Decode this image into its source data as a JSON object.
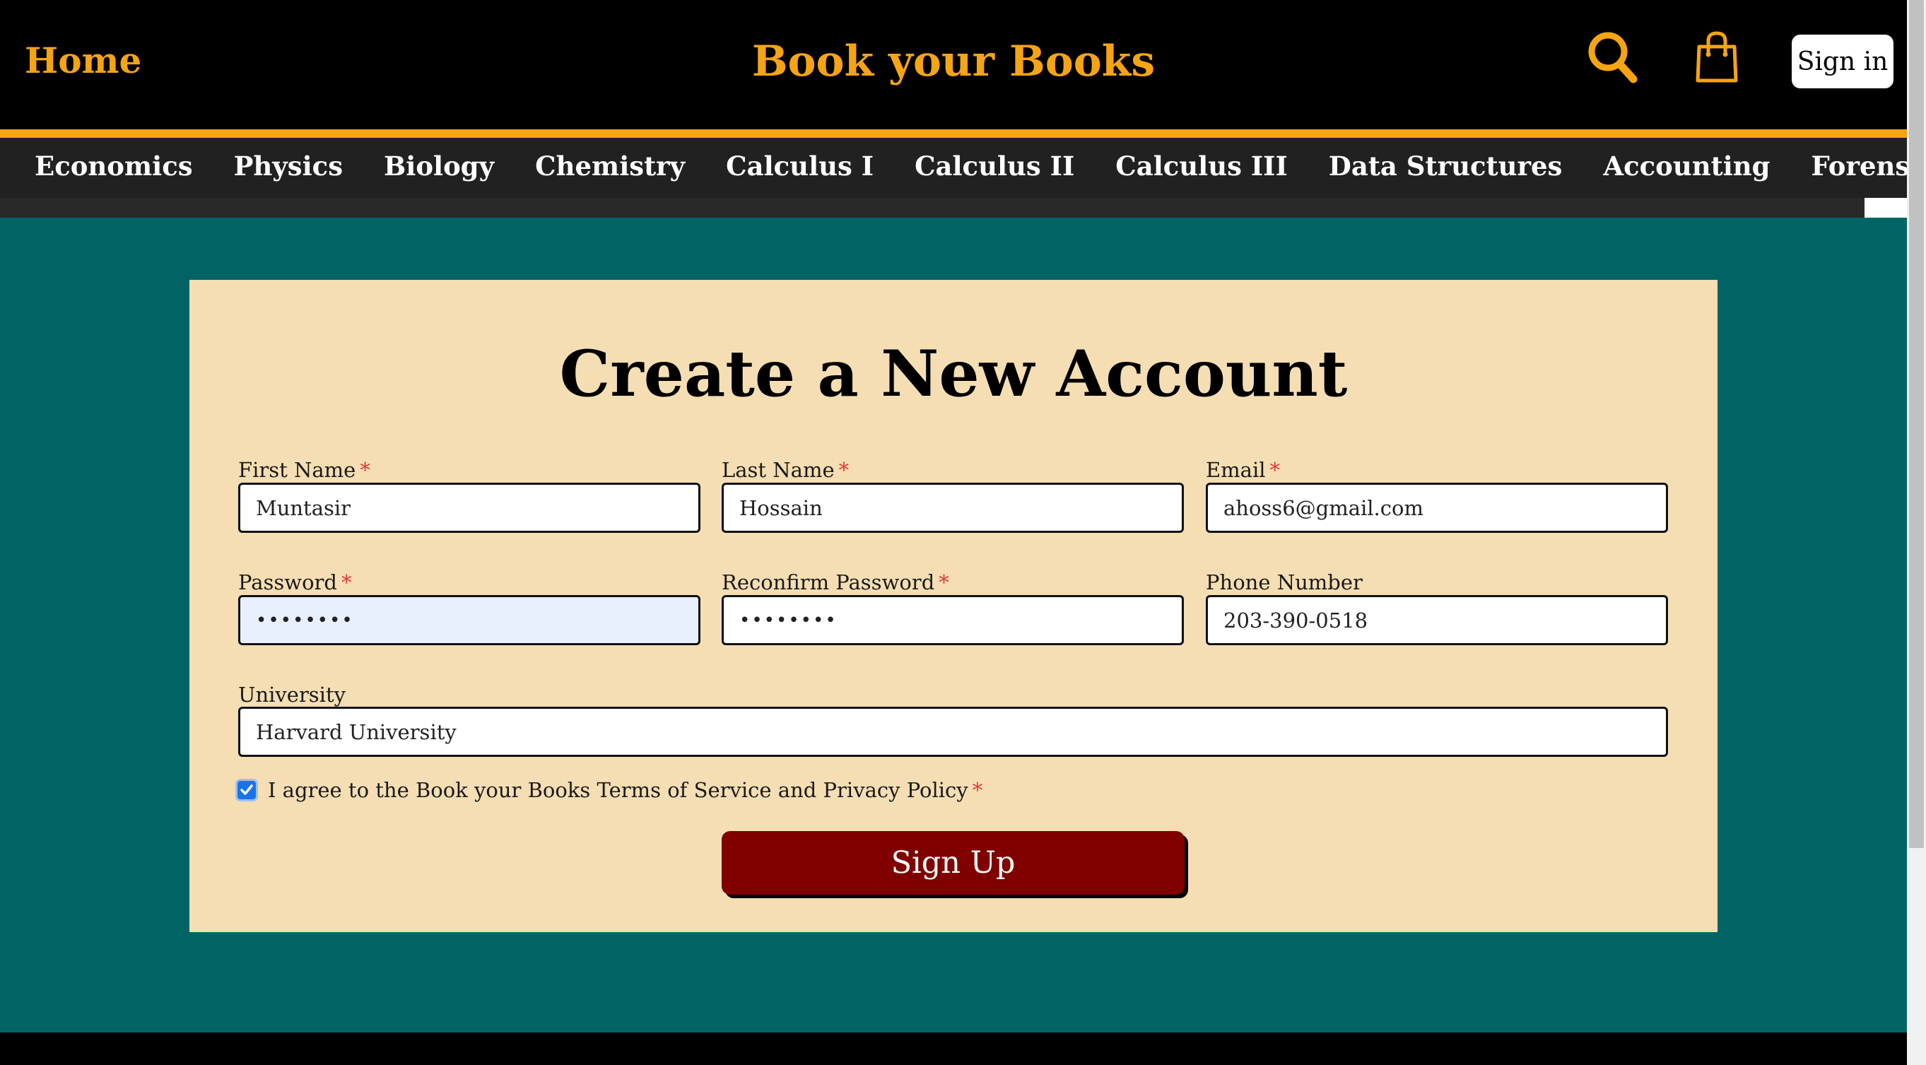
{
  "header": {
    "home_label": "Home",
    "brand": "Book your Books",
    "search_icon": "search-icon",
    "cart_icon": "shopping-bag-icon",
    "signin_label": "Sign in"
  },
  "categories": [
    "Economics",
    "Physics",
    "Biology",
    "Chemistry",
    "Calculus I",
    "Calculus II",
    "Calculus III",
    "Data Structures",
    "Accounting",
    "Forensic Science"
  ],
  "form": {
    "title": "Create a New Account",
    "required_marker": "*",
    "first_name": {
      "label": "First Name",
      "value": "Muntasir"
    },
    "last_name": {
      "label": "Last Name",
      "value": "Hossain"
    },
    "email": {
      "label": "Email",
      "value": "ahoss6@gmail.com"
    },
    "password": {
      "label": "Password",
      "value": "••••••••"
    },
    "reconfirm_password": {
      "label": "Reconfirm Password",
      "value": "••••••••"
    },
    "phone": {
      "label": "Phone Number",
      "value": "203-390-0518"
    },
    "university": {
      "label": "University",
      "value": "Harvard University"
    },
    "terms": {
      "label": "I agree to the Book your Books Terms of Service and Privacy Policy",
      "checked": true
    },
    "submit_label": "Sign Up"
  },
  "colors": {
    "accent": "#f5a414",
    "header_bg": "#000000",
    "nav_bg": "#212121",
    "page_bg": "#006464",
    "card_bg": "#f5deb3",
    "button_bg": "#800000",
    "required": "#e53935",
    "checkbox": "#1a73e8"
  }
}
